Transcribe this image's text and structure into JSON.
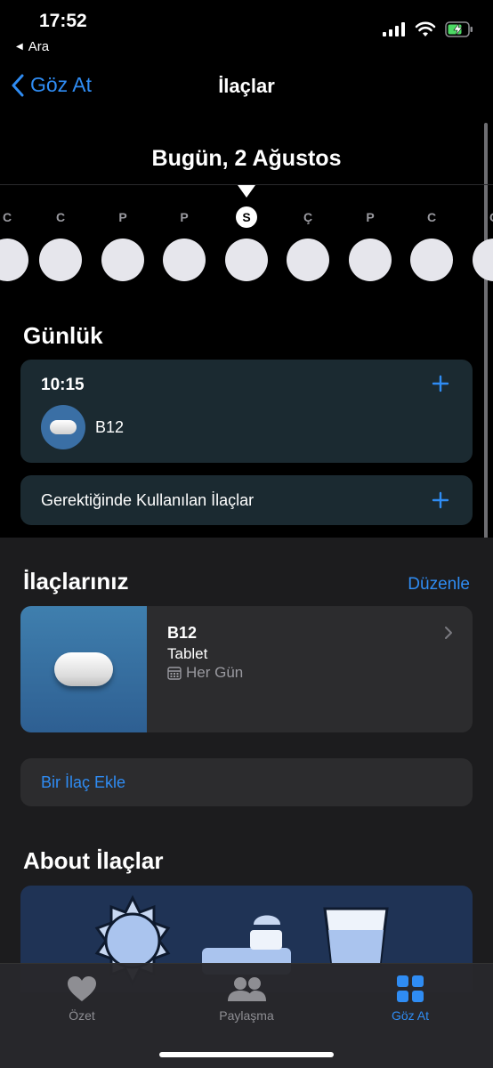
{
  "status_bar": {
    "time": "17:52",
    "back_app": "Ara",
    "icons": [
      "cellular-icon",
      "wifi-icon",
      "battery-charging-icon"
    ]
  },
  "nav": {
    "back_label": "Göz At",
    "title": "İlaçlar"
  },
  "date": {
    "title": "Bugün, 2 Ağustos",
    "days": [
      {
        "letter": "C"
      },
      {
        "letter": "C"
      },
      {
        "letter": "P"
      },
      {
        "letter": "P"
      },
      {
        "letter": "S",
        "active": true
      },
      {
        "letter": "Ç"
      },
      {
        "letter": "P"
      },
      {
        "letter": "C"
      },
      {
        "letter": "C"
      }
    ]
  },
  "daily": {
    "title": "Günlük",
    "time": "10:15",
    "med_name": "B12",
    "as_needed_label": "Gerektiğinde Kullanılan İlaçlar"
  },
  "your_meds": {
    "title": "İlaçlarınız",
    "edit_label": "Düzenle",
    "items": [
      {
        "name": "B12",
        "form": "Tablet",
        "schedule": "Her Gün"
      }
    ],
    "add_label": "Bir İlaç Ekle"
  },
  "about": {
    "title": "About İlaçlar"
  },
  "tabbar": {
    "tabs": [
      {
        "label": "Özet",
        "icon": "heart-icon"
      },
      {
        "label": "Paylaşma",
        "icon": "people-icon"
      },
      {
        "label": "Göz At",
        "icon": "grid-icon",
        "active": true
      }
    ]
  },
  "colors": {
    "accent": "#2f8cf3",
    "card": "#1b2a31",
    "background": "#000000"
  }
}
